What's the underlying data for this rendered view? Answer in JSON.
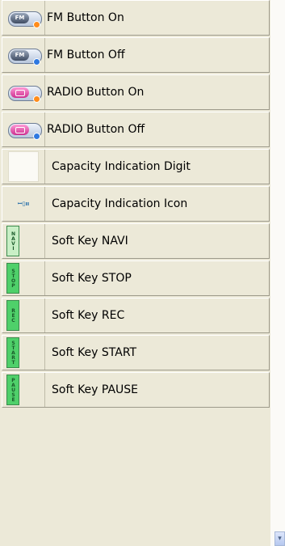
{
  "items": [
    {
      "label": "FM Button On",
      "icon": "fm-button-on-icon",
      "knob_text": "FM",
      "status": "orange"
    },
    {
      "label": "FM Button Off",
      "icon": "fm-button-off-icon",
      "knob_text": "FM",
      "status": "blue"
    },
    {
      "label": "RADIO Button On",
      "icon": "radio-button-on-icon",
      "status": "orange"
    },
    {
      "label": "RADIO Button Off",
      "icon": "radio-button-off-icon",
      "status": "blue"
    },
    {
      "label": "Capacity Indication Digit",
      "icon": "capacity-digit-icon"
    },
    {
      "label": "Capacity Indication Icon",
      "icon": "capacity-indicator-icon",
      "mini_text": "ꟷ▯ıı"
    },
    {
      "label": "Soft Key NAVI",
      "icon": "softkey-navi-icon",
      "key_text": "NAVI"
    },
    {
      "label": "Soft Key STOP",
      "icon": "softkey-stop-icon",
      "key_text": "STOP"
    },
    {
      "label": "Soft Key REC",
      "icon": "softkey-rec-icon",
      "key_text": "REC"
    },
    {
      "label": "Soft Key START",
      "icon": "softkey-start-icon",
      "key_text": "START"
    },
    {
      "label": "Soft Key PAUSE",
      "icon": "softkey-pause-icon",
      "key_text": "PAUSE"
    }
  ],
  "colors": {
    "status_on": "#ff8c1a",
    "status_off": "#2f78e0",
    "softkey_green": "#4fd06a",
    "softkey_light": "#c9efc6"
  },
  "scrollbar": {
    "down_arrow": "▾"
  }
}
